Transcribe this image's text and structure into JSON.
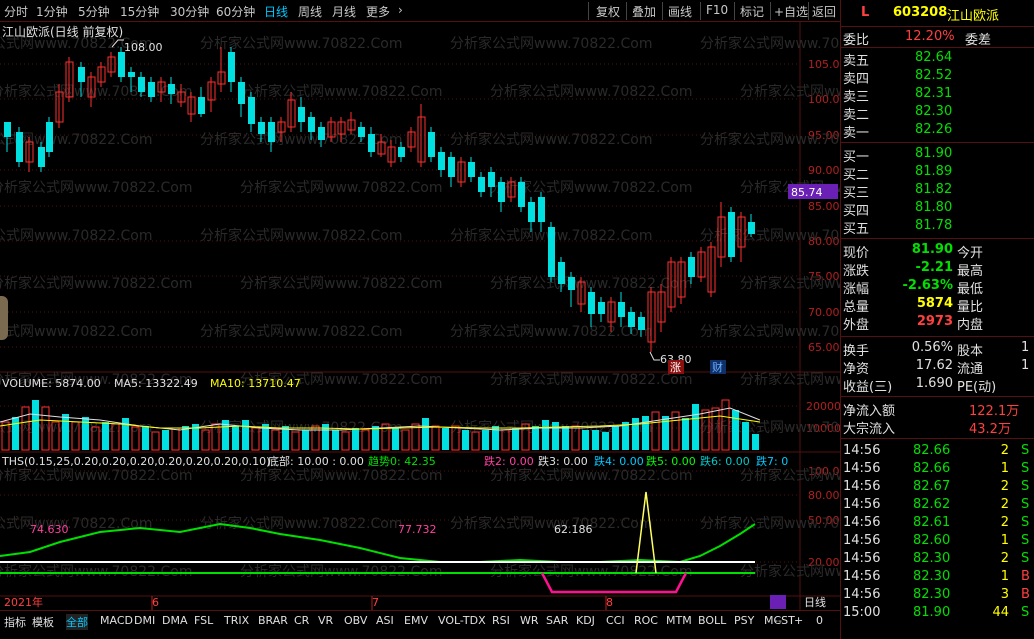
{
  "toolbar": {
    "left_tabs": [
      "分时",
      "1分钟",
      "5分钟",
      "15分钟",
      "30分钟",
      "60分钟",
      "日线",
      "周线",
      "月线",
      "更多"
    ],
    "active": "日线",
    "more_arrow": "›",
    "right_tabs": [
      "复权",
      "叠加",
      "画线",
      "F10",
      "标记",
      "+自选",
      "返回"
    ]
  },
  "chart": {
    "title": "江山欧派(日线 前复权)",
    "high_label": "108.00",
    "low_label": "63.80",
    "current_price_tag": "85.74",
    "price_ticks": [
      "105.0",
      "100.0",
      "95.00",
      "90.00",
      "85.00",
      "80.00",
      "75.00",
      "70.00",
      "65.00"
    ],
    "badge_zhang": "涨",
    "badge_cai": "财",
    "watermark": "分析家公式网www.70822.Com"
  },
  "volume": {
    "label": "VOLUME: 5874.00",
    "ma5": "MA5: 13322.49",
    "ma10": "MA10: 13710.47",
    "ticks": [
      "20000",
      "10000"
    ]
  },
  "ths": {
    "label": "THS(0.15,25,0.20,0.20,0.20,0.20,0.20,0.20,0.10)",
    "bottom": "底部: 10.00 : 0.00",
    "trend": "趋势0: 42.35",
    "die2": "跌2: 0.00",
    "die3": "跌3: 0.00",
    "die4": "跌4: 0.00",
    "die5": "跌5: 0.00",
    "die6": "跌6: 0.00",
    "die7": "跌7: 0",
    "ticks": [
      "100.0",
      "80.00",
      "50.00",
      "20.00"
    ],
    "annot1": "74.630",
    "annot2": "77.732",
    "annot3": "62.186"
  },
  "date_axis": {
    "d1": "2021年",
    "d2": "6",
    "d3": "7",
    "d4": "8",
    "period": "日线"
  },
  "bottom_tabs": [
    "指标",
    "模板",
    "全部",
    "MACD",
    "DMI",
    "DMA",
    "FSL",
    "TRIX",
    "BRAR",
    "CR",
    "VR",
    "OBV",
    "ASI",
    "EMV",
    "VOL-TDX",
    "RSI",
    "WR",
    "SAR",
    "KDJ",
    "CCI",
    "ROC",
    "MTM",
    "BOLL",
    "PSY",
    "MCST"
  ],
  "bottom_active": "全部",
  "bottom_right": [
    "--",
    "+",
    "0"
  ],
  "quote": {
    "code": "603208",
    "name": "江山欧派",
    "l_tag": "L",
    "webi_label": "委比",
    "webi_value": "12.20%",
    "weicha_label": "委差",
    "sell": [
      {
        "label": "卖五",
        "price": "82.64"
      },
      {
        "label": "卖四",
        "price": "82.52"
      },
      {
        "label": "卖三",
        "price": "82.31"
      },
      {
        "label": "卖二",
        "price": "82.30"
      },
      {
        "label": "卖一",
        "price": "82.26"
      }
    ],
    "buy": [
      {
        "label": "买一",
        "price": "81.90"
      },
      {
        "label": "买二",
        "price": "81.89"
      },
      {
        "label": "买三",
        "price": "81.82"
      },
      {
        "label": "买四",
        "price": "81.80"
      },
      {
        "label": "买五",
        "price": "81.78"
      }
    ],
    "stats": [
      {
        "l": "现价",
        "v": "81.90",
        "r": "今开",
        "c": "#00e000"
      },
      {
        "l": "涨跌",
        "v": "-2.21",
        "r": "最高",
        "c": "#00e000"
      },
      {
        "l": "涨幅",
        "v": "-2.63%",
        "r": "最低",
        "c": "#00e000"
      },
      {
        "l": "总量",
        "v": "5874",
        "r": "量比",
        "c": "#ffff00"
      },
      {
        "l": "外盘",
        "v": "2973",
        "r": "内盘",
        "c": "#ff4040"
      }
    ],
    "stats2": [
      {
        "l": "换手",
        "v": "0.56%",
        "r": "股本",
        "x": "1"
      },
      {
        "l": "净资",
        "v": "17.62",
        "r": "流通",
        "x": "1"
      },
      {
        "l": "收益(三)",
        "v": "1.690",
        "r": "PE(动)",
        "x": ""
      }
    ],
    "flow": [
      {
        "l": "净流入额",
        "v": "122.1万"
      },
      {
        "l": "大宗流入",
        "v": "43.2万"
      }
    ],
    "ticks": [
      {
        "t": "14:56",
        "p": "82.66",
        "q": "2",
        "s": "S"
      },
      {
        "t": "14:56",
        "p": "82.66",
        "q": "1",
        "s": "S"
      },
      {
        "t": "14:56",
        "p": "82.67",
        "q": "2",
        "s": "S"
      },
      {
        "t": "14:56",
        "p": "82.62",
        "q": "2",
        "s": "S"
      },
      {
        "t": "14:56",
        "p": "82.61",
        "q": "2",
        "s": "S"
      },
      {
        "t": "14:56",
        "p": "82.60",
        "q": "1",
        "s": "S"
      },
      {
        "t": "14:56",
        "p": "82.30",
        "q": "2",
        "s": "S"
      },
      {
        "t": "14:56",
        "p": "82.30",
        "q": "1",
        "s": "B"
      },
      {
        "t": "14:56",
        "p": "82.30",
        "q": "3",
        "s": "B"
      },
      {
        "t": "15:00",
        "p": "81.90",
        "q": "44",
        "s": "S"
      }
    ]
  }
}
